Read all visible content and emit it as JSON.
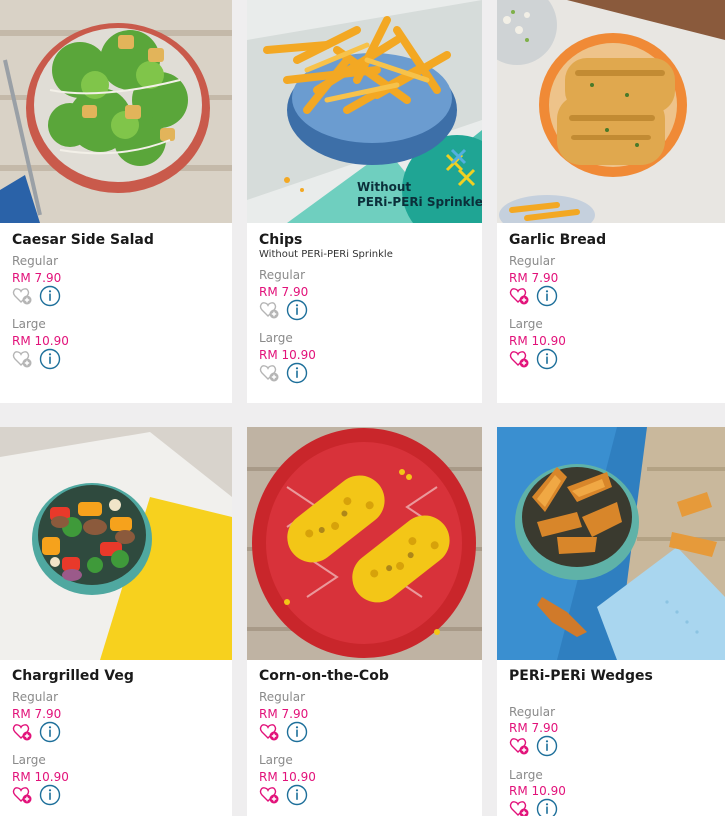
{
  "colors": {
    "price": "#e2127a",
    "info_ring": "#1d6f9a",
    "fav_active": "#e2127a",
    "fav_inactive": "#b5b5b5"
  },
  "items": [
    {
      "name": "Caesar Side Salad",
      "subtitle": "",
      "sizes": [
        {
          "label": "Regular",
          "price": "RM 7.90"
        },
        {
          "label": "Large",
          "price": "RM 10.90"
        }
      ],
      "favorite_active": false
    },
    {
      "name": "Chips",
      "subtitle": "Without PERi-PERi Sprinkle",
      "photo_overlay": "Without\nPERi-PERi Sprinkle",
      "sizes": [
        {
          "label": "Regular",
          "price": "RM 7.90"
        },
        {
          "label": "Large",
          "price": "RM 10.90"
        }
      ],
      "favorite_active": false
    },
    {
      "name": "Garlic Bread",
      "subtitle": "",
      "sizes": [
        {
          "label": "Regular",
          "price": "RM 7.90"
        },
        {
          "label": "Large",
          "price": "RM 10.90"
        }
      ],
      "favorite_active": true
    },
    {
      "name": "Chargrilled Veg",
      "subtitle": "",
      "sizes": [
        {
          "label": "Regular",
          "price": "RM 7.90"
        },
        {
          "label": "Large",
          "price": "RM 10.90"
        }
      ],
      "favorite_active": true
    },
    {
      "name": "Corn-on-the-Cob",
      "subtitle": "",
      "sizes": [
        {
          "label": "Regular",
          "price": "RM 7.90"
        },
        {
          "label": "Large",
          "price": "RM 10.90"
        }
      ],
      "favorite_active": true
    },
    {
      "name": "PERi-PERi Wedges",
      "subtitle": "",
      "sizes": [
        {
          "label": "Regular",
          "price": "RM 7.90"
        },
        {
          "label": "Large",
          "price": "RM 10.90"
        }
      ],
      "favorite_active": true
    }
  ],
  "icons": {
    "favorite": "heart-plus-icon",
    "info": "info-icon"
  }
}
